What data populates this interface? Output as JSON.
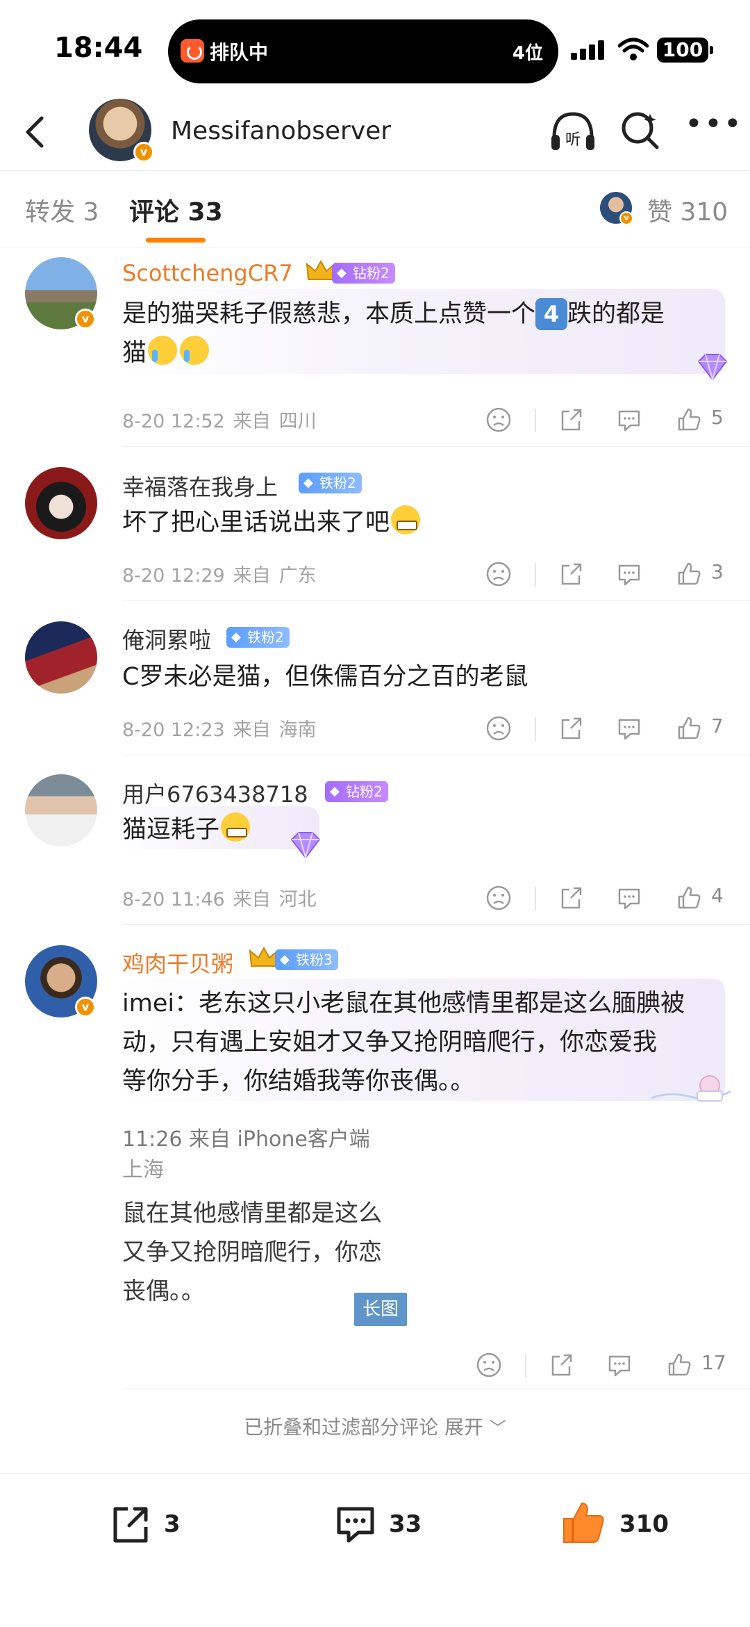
{
  "status": {
    "time": "18:44",
    "island_text": "排队中",
    "island_queue": "4位",
    "battery": "100"
  },
  "nav": {
    "title": "Messifanobserver",
    "listen_label": "听"
  },
  "tabs": {
    "repost": "转发 3",
    "comments": "评论 33",
    "likes": "赞 310"
  },
  "comments": [
    {
      "name": "ScottchengCR7",
      "badge": "钻粉2",
      "text_a": "是的猫哭耗子假慈悲，本质上点赞一个",
      "num": "4",
      "text_b": "跌的都是",
      "text_c": "猫",
      "date": "8-20 12:52",
      "from": "来自",
      "region": "四川",
      "likes": "5"
    },
    {
      "name": "幸福落在我身上",
      "badge": "铁粉2",
      "text": "坏了把心里话说出来了吧",
      "date": "8-20 12:29",
      "from": "来自",
      "region": "广东",
      "likes": "3"
    },
    {
      "name": "俺洞累啦",
      "badge": "铁粉2",
      "text": "C罗未必是猫，但侏儒百分之百的老鼠",
      "date": "8-20 12:23",
      "from": "来自",
      "region": "海南",
      "likes": "7"
    },
    {
      "name": "用户6763438718",
      "badge": "钻粉2",
      "text": "猫逗耗子",
      "date": "8-20 11:46",
      "from": "来自",
      "region": "河北",
      "likes": "4"
    },
    {
      "name": "鸡肉干贝粥",
      "badge": "铁粉3",
      "line1": "imei：老东这只小老鼠在其他感情里都是这么腼腆被",
      "line2": "动，只有遇上安姐才又争又抢阴暗爬行，你恋爱我",
      "line3": "等你分手，你结婚我等你丧偶。。",
      "img_meta1": "11:26  来自 iPhone客户端",
      "img_meta2": "上海",
      "img_l1": "鼠在其他感情里都是这么",
      "img_l2": "又争又抢阴暗爬行，你恋",
      "img_l3": "丧偶。。",
      "long_img": "长图",
      "likes": "17"
    }
  ],
  "folded": "已折叠和过滤部分评论 展开",
  "bottom": {
    "repost": "3",
    "comment": "33",
    "like": "310"
  },
  "colors": {
    "accent": "#ff8200",
    "vip_name": "#ee7a24",
    "like_orange": "#ff8a2c"
  }
}
